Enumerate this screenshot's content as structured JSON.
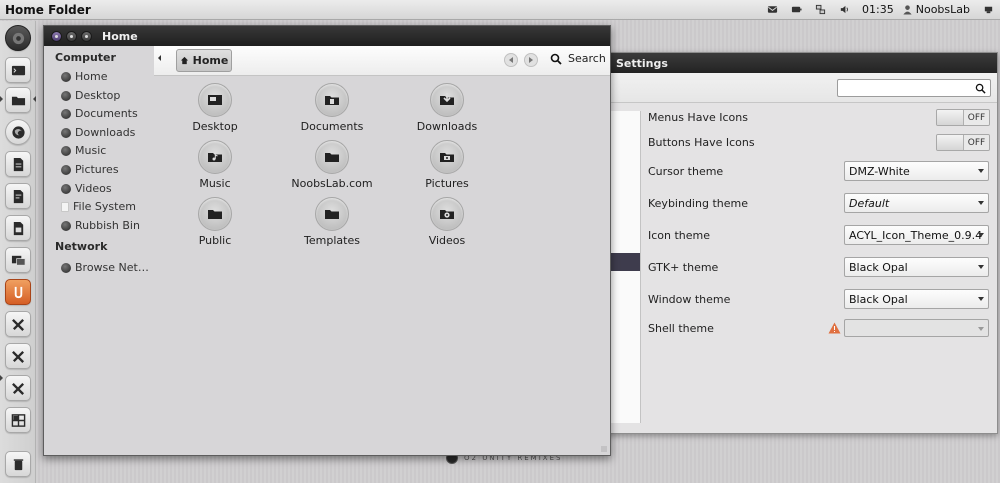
{
  "top_panel": {
    "title": "Home Folder",
    "clock": "01:35",
    "user": "NoobsLab",
    "tray_icons": [
      "mail-icon",
      "battery-icon",
      "network-icon",
      "volume-icon"
    ]
  },
  "launcher": {
    "items": [
      "dash-icon",
      "terminal-icon",
      "files-icon",
      "firefox-icon",
      "document-icon",
      "text-editor-icon",
      "viewer-icon",
      "monitor-icon",
      "ubuntu-one-icon",
      "tools-icon",
      "tools-icon",
      "tools-icon",
      "workspaces-icon",
      "trash-icon"
    ]
  },
  "settings_window": {
    "title": "Settings",
    "search_placeholder": "",
    "rows": [
      {
        "label": "Menus Have Icons",
        "control": "toggle",
        "value": "OFF"
      },
      {
        "label": "Buttons Have Icons",
        "control": "toggle",
        "value": "OFF"
      },
      {
        "label": "Cursor theme",
        "control": "combo",
        "value": "DMZ-White"
      },
      {
        "label": "Keybinding theme",
        "control": "combo",
        "value": "Default"
      },
      {
        "label": "Icon theme",
        "control": "combo",
        "value": "ACYL_Icon_Theme_0.9.4"
      },
      {
        "label": "GTK+ theme",
        "control": "combo",
        "value": "Black Opal"
      },
      {
        "label": "Window theme",
        "control": "combo",
        "value": "Black Opal"
      },
      {
        "label": "Shell theme",
        "control": "combo",
        "value": ""
      }
    ]
  },
  "watermark": {
    "text": "O2 UNITY REMIXES"
  },
  "files_window": {
    "title": "Home",
    "pathbar": {
      "current": "Home",
      "search_label": "Search"
    },
    "sidebar": {
      "computer_header": "Computer",
      "computer_items": [
        "Home",
        "Desktop",
        "Documents",
        "Downloads",
        "Music",
        "Pictures",
        "Videos",
        "File System",
        "Rubbish Bin"
      ],
      "network_header": "Network",
      "network_items": [
        "Browse Net…"
      ]
    },
    "folders": [
      {
        "label": "Desktop",
        "icon": "desktop-folder-icon"
      },
      {
        "label": "Documents",
        "icon": "documents-folder-icon"
      },
      {
        "label": "Downloads",
        "icon": "downloads-folder-icon"
      },
      {
        "label": "Music",
        "icon": "music-folder-icon"
      },
      {
        "label": "NoobsLab.com",
        "icon": "folder-icon"
      },
      {
        "label": "Pictures",
        "icon": "pictures-folder-icon"
      },
      {
        "label": "Public",
        "icon": "folder-icon"
      },
      {
        "label": "Templates",
        "icon": "folder-icon"
      },
      {
        "label": "Videos",
        "icon": "videos-folder-icon"
      }
    ]
  }
}
